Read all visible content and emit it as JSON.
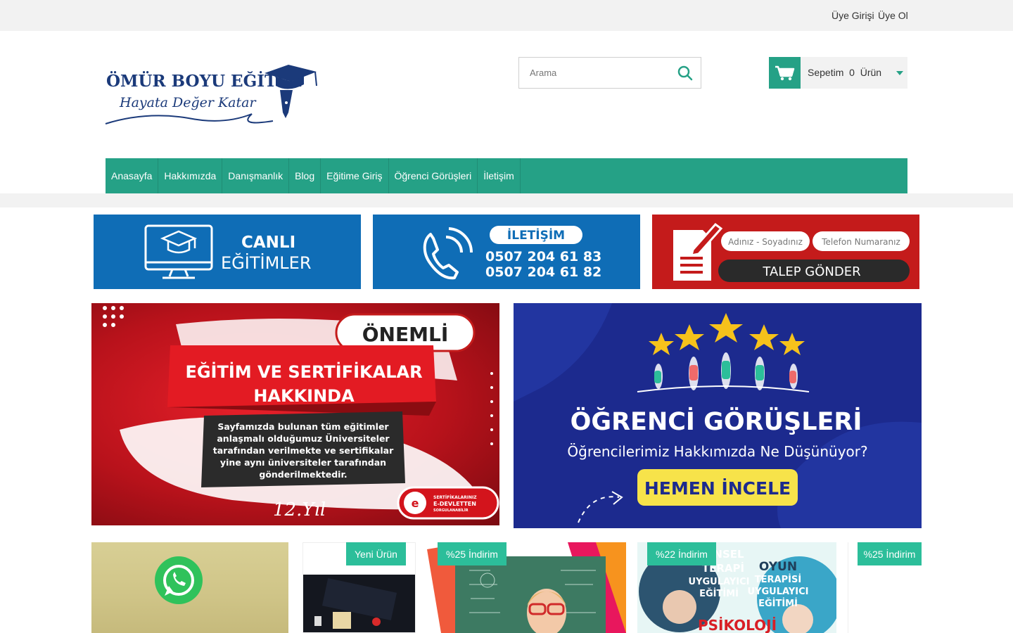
{
  "topbar": {
    "login": "Üye Girişi",
    "register": "Üye Ol"
  },
  "logo": {
    "name": "ÖMÜR BOYU EĞİTİM",
    "slogan": "Hayata Değer Katar"
  },
  "search": {
    "placeholder": "Arama"
  },
  "cart": {
    "label": "Sepetim",
    "count": "0",
    "unit": "Ürün"
  },
  "nav": {
    "items": [
      "Anasayfa",
      "Hakkımızda",
      "Danışmanlık",
      "Blog",
      "Eğitime Giriş",
      "Öğrenci Görüşleri",
      "İletişim"
    ]
  },
  "banners": {
    "live": {
      "line1": "CANLI",
      "line2": "EĞİTİMLER"
    },
    "contact": {
      "title": "İLETİŞİM",
      "phone1": "0507 204 61 83",
      "phone2": "0507 204 61 82"
    },
    "request": {
      "field1": "Adınız - Soyadınız",
      "field2": "Telefon Numaranız",
      "button": "TALEP GÖNDER"
    }
  },
  "promo_left": {
    "tag": "ÖNEMLİ",
    "title1": "EĞİTİM VE SERTİFİKALAR",
    "title2": "HAKKINDA",
    "body": [
      "Sayfamızda bulunan tüm eğitimler",
      "anlaşmalı olduğumuz Üniversiteler",
      "tarafından verilmekte ve sertifikalar",
      "yine aynı üniversiteler tarafından",
      "gönderilmektedir."
    ],
    "year": "12.Yıl",
    "seal": [
      "SERTİFİKALARINIZ",
      "E-DEVLETTEN",
      "SORGULANABİLİR"
    ]
  },
  "promo_right": {
    "title": "ÖĞRENCİ GÖRÜŞLERİ",
    "subtitle": "Öğrencilerimiz Hakkımızda Ne Düşünüyor?",
    "button": "HEMEN İNCELE"
  },
  "products": {
    "badges": [
      "Yeni Ürün",
      "%25 İndirim",
      "%22 İndirim",
      "%25 İndirim"
    ],
    "card4_text": [
      "NSEL",
      "TERAPİ",
      "UYGULAYICI",
      "EĞİTİMİ",
      "OYUN",
      "TERAPİSİ",
      "UYGULAYICI",
      "EĞİTİMİ",
      "PSİKOLOJİ"
    ]
  },
  "colors": {
    "brand_green": "#25a186",
    "badge_green": "#2cbe9a",
    "banner_blue": "#0f6db6",
    "banner_red": "#c41b1b",
    "navy": "#1c2a8e",
    "logo_navy": "#1b3a7a"
  }
}
